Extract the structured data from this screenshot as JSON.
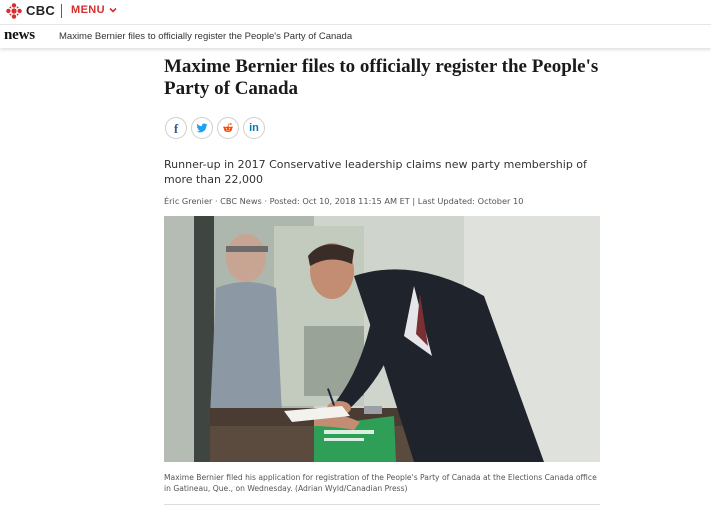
{
  "brand": {
    "name": "CBC",
    "accent": "#d32f2f",
    "menu_label": "MENU"
  },
  "newsbar": {
    "section": "news",
    "headline": "Maxime Bernier files to officially register the People's Party of Canada"
  },
  "article": {
    "title": "Maxime Bernier files to officially register the People's Party of Canada",
    "share": [
      {
        "icon": "facebook-icon"
      },
      {
        "icon": "twitter-icon"
      },
      {
        "icon": "reddit-icon"
      },
      {
        "icon": "linkedin-icon"
      }
    ],
    "deck": "Runner-up in 2017 Conservative leadership claims new party membership of more than 22,000",
    "byline": "Éric Grenier · CBC News · Posted: Oct 10, 2018 11:15 AM ET | Last Updated: October 10",
    "photo_caption": "Maxime Bernier filed his application for registration of the People's Party of Canada at the Elections Canada office in Gatineau, Que., on Wednesday. (Adrian Wyld/Canadian Press)"
  }
}
